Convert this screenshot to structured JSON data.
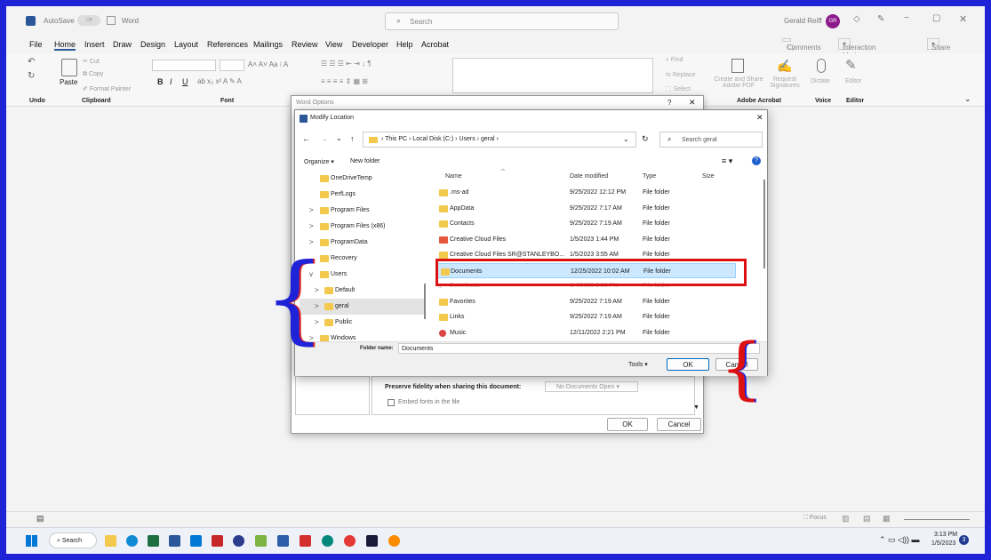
{
  "titlebar": {
    "autosave": "AutoSave",
    "autosave_state": "Off",
    "app_name": "Word",
    "search_placeholder": "Search",
    "user_name": "Gerald Reiff",
    "user_initials": "GR"
  },
  "menu": [
    "File",
    "Home",
    "Insert",
    "Draw",
    "Design",
    "Layout",
    "References",
    "Mailings",
    "Review",
    "View",
    "Developer",
    "Help",
    "Acrobat"
  ],
  "menu_right": {
    "comments": "Comments",
    "interaction": "Interaction Modes",
    "share": "Share"
  },
  "ribbon": {
    "paste": "Paste",
    "cut": "Cut",
    "copy": "Copy",
    "format_painter": "Format Painter",
    "find": "Find",
    "replace": "Replace",
    "select": "Select",
    "create_share": "Create and Share Adobe PDF",
    "request_sig": "Request Signatures",
    "dictate": "Dictate",
    "editor": "Editor",
    "groups": {
      "undo": "Undo",
      "clipboard": "Clipboard",
      "font": "Font",
      "acrobat": "Adobe Acrobat",
      "voice": "Voice",
      "editor": "Editor"
    }
  },
  "word_options": {
    "title": "Word Options",
    "help": "?",
    "preserve_label": "Preserve fidelity when sharing this document:",
    "preserve_value": "No Documents Open",
    "embed_fonts": "Embed fonts in the file",
    "ok": "OK",
    "cancel": "Cancel"
  },
  "modify_location": {
    "title": "Modify Location",
    "breadcrumb": [
      "This PC",
      "Local Disk (C:)",
      "Users",
      "geral"
    ],
    "search_placeholder": "Search geral",
    "organize": "Organize",
    "new_folder": "New folder",
    "columns": {
      "name": "Name",
      "date": "Date modified",
      "type": "Type",
      "size": "Size"
    },
    "tree": [
      {
        "label": "OneDriveTemp",
        "chevron": ""
      },
      {
        "label": "PerfLogs",
        "chevron": ""
      },
      {
        "label": "Program Files",
        "chevron": ">"
      },
      {
        "label": "Program Files (x86)",
        "chevron": ">"
      },
      {
        "label": "ProgramData",
        "chevron": ">"
      },
      {
        "label": "Recovery",
        "chevron": ""
      },
      {
        "label": "Users",
        "chevron": "v"
      },
      {
        "label": "Default",
        "chevron": ">"
      },
      {
        "label": "geral",
        "chevron": ">"
      },
      {
        "label": "Public",
        "chevron": ">"
      },
      {
        "label": "Windows",
        "chevron": ">"
      }
    ],
    "files": [
      {
        "name": ".ms-ad",
        "date": "9/25/2022 12:12 PM",
        "type": "File folder"
      },
      {
        "name": "AppData",
        "date": "9/25/2022 7:17 AM",
        "type": "File folder"
      },
      {
        "name": "Contacts",
        "date": "9/25/2022 7:19 AM",
        "type": "File folder"
      },
      {
        "name": "Creative Cloud Files",
        "date": "1/5/2023 1:44 PM",
        "type": "File folder"
      },
      {
        "name": "Creative Cloud Files SR@STANLEYBO...",
        "date": "1/5/2023 3:55 AM",
        "type": "File folder"
      },
      {
        "name": "Documents",
        "date": "12/25/2022 10:02 AM",
        "type": "File folder"
      },
      {
        "name": "Downloads",
        "date": "1/4/2023 2:55 PM",
        "type": "File folder"
      },
      {
        "name": "Favorites",
        "date": "9/25/2022 7:19 AM",
        "type": "File folder"
      },
      {
        "name": "Links",
        "date": "9/25/2022 7:19 AM",
        "type": "File folder"
      },
      {
        "name": "Music",
        "date": "12/11/2022 2:21 PM",
        "type": "File folder"
      }
    ],
    "folder_name_label": "Folder name:",
    "folder_name_value": "Documents",
    "tools": "Tools",
    "ok": "OK",
    "cancel": "Cancel"
  },
  "status": {
    "focus": "Focus"
  },
  "taskbar": {
    "search": "Search",
    "time": "3:13 PM",
    "date": "1/5/2023",
    "notif": "3"
  },
  "colors": {
    "frame": "#1f23d8",
    "annotation_red": "#dd1111",
    "word_blue": "#2b579a",
    "selection": "#cce8ff"
  }
}
